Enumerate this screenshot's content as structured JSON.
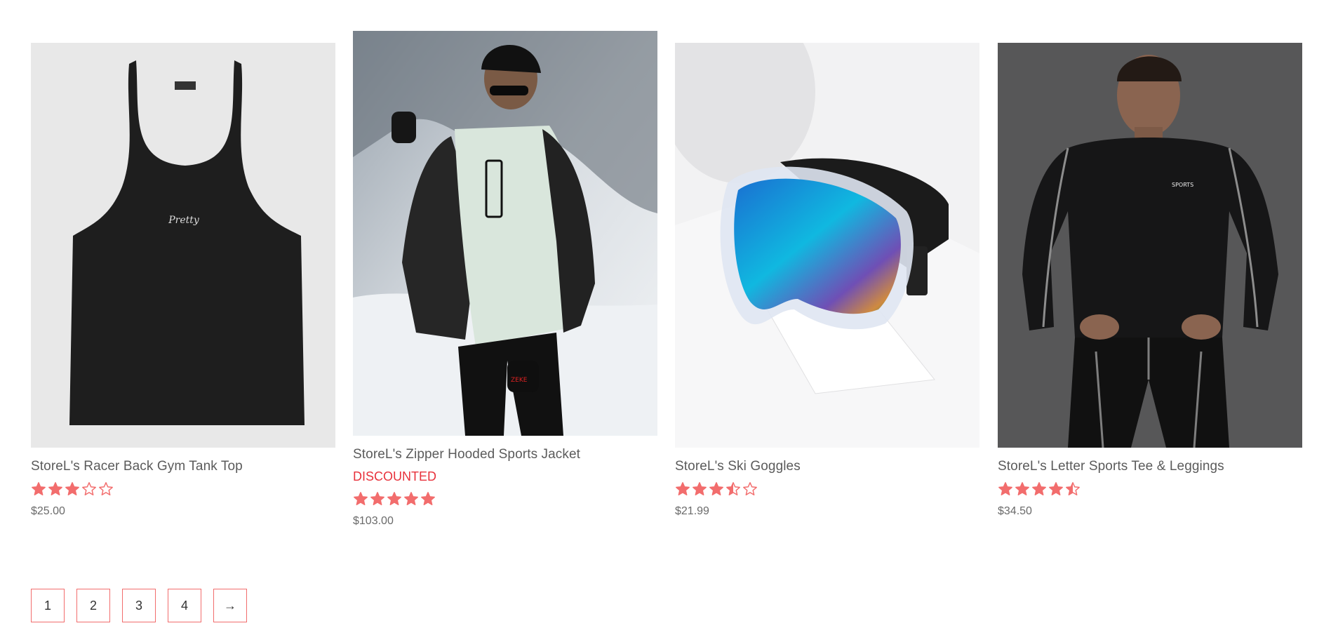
{
  "accent_color": "#f26d6d",
  "discount_color": "#e8323c",
  "products": [
    {
      "title": "StoreL's Racer Back Gym Tank Top",
      "badge": "",
      "rating": 3,
      "price": "$25.00",
      "image": "black-tank-top"
    },
    {
      "title": "StoreL's Zipper Hooded Sports Jacket",
      "badge": "DISCOUNTED",
      "rating": 5,
      "price": "$103.00",
      "image": "man-in-ski-jacket"
    },
    {
      "title": "StoreL's Ski Goggles",
      "badge": "",
      "rating": 3.5,
      "price": "$21.99",
      "image": "ski-goggles"
    },
    {
      "title": "StoreL's Letter Sports Tee & Leggings",
      "badge": "",
      "rating": 4.5,
      "price": "$34.50",
      "image": "man-in-compression-wear"
    }
  ],
  "pagination": {
    "pages": [
      "1",
      "2",
      "3",
      "4"
    ],
    "next_label": "→"
  }
}
